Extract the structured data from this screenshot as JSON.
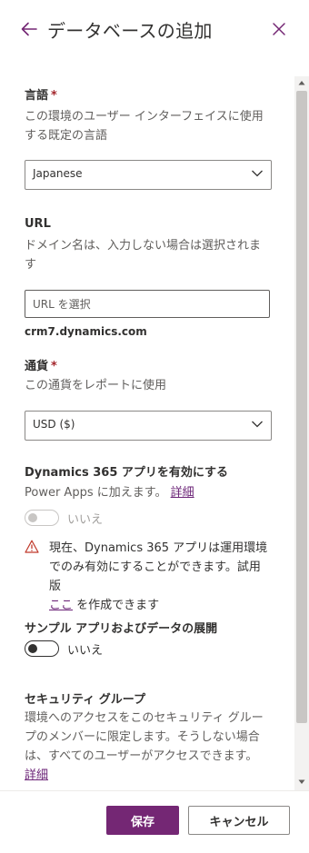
{
  "panel": {
    "title": "データベースの追加",
    "back_icon": "arrow-left-icon",
    "close_icon": "close-icon",
    "accent_color": "#742774"
  },
  "language": {
    "label": "言語",
    "required_mark": "*",
    "description": "この環境のユーザー インターフェイスに使用する既定の言語",
    "selected": "Japanese"
  },
  "url": {
    "label": "URL",
    "description": "ドメイン名は、入力しない場合は選択されます",
    "placeholder": "URL を選択",
    "value": "",
    "domain": "crm7.dynamics.com"
  },
  "currency": {
    "label": "通貨",
    "required_mark": "*",
    "description": "この通貨をレポートに使用",
    "selected": "USD ($)"
  },
  "dynamics": {
    "label": "Dynamics 365 アプリを有効にする",
    "description": "Power Apps に加えます。",
    "details_link": "詳細",
    "toggle_text": "いいえ",
    "toggle_on": false,
    "toggle_disabled": true,
    "warning_icon": "warning-icon",
    "warning_text_1": "現在、Dynamics 365 アプリは運用環境でのみ有効にすることができます。試用版",
    "warning_link": "ここ",
    "warning_text_2": "を作成できます"
  },
  "sample_apps": {
    "label": "サンプル アプリおよびデータの展開",
    "toggle_text": "いいえ",
    "toggle_on": false
  },
  "security": {
    "label": "セキュリティ グループ",
    "description": "環境へのアクセスをこのセキュリティ グループのメンバーに限定します。そうしない場合は、すべてのユーザーがアクセスできます。",
    "details_link": "詳細"
  },
  "footer": {
    "save_label": "保存",
    "cancel_label": "キャンセル"
  }
}
